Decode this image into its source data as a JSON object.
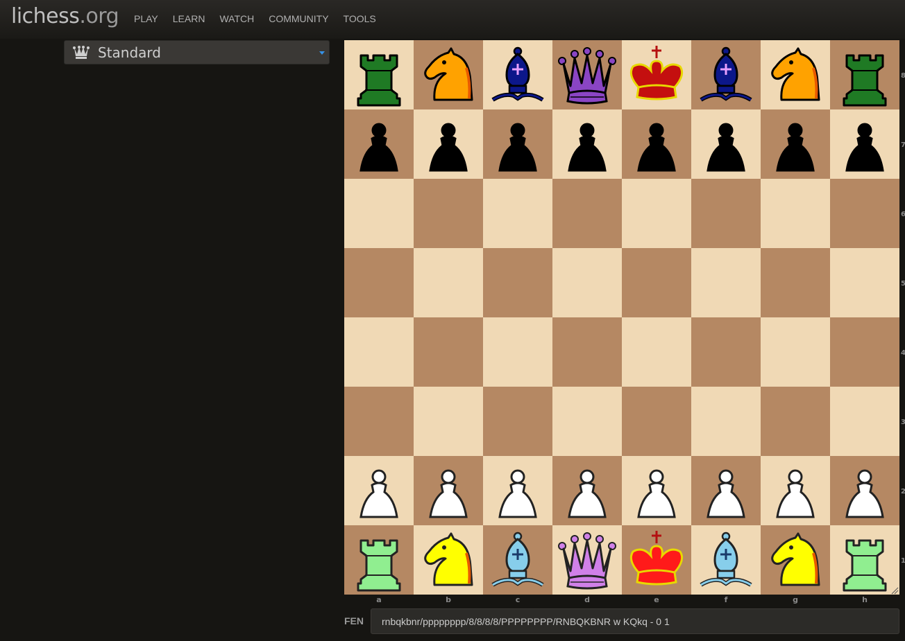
{
  "app": {
    "logo_main": "lichess",
    "logo_tld": ".org"
  },
  "nav": [
    "PLAY",
    "LEARN",
    "WATCH",
    "COMMUNITY",
    "TOOLS"
  ],
  "variant": {
    "icon": "crown-icon",
    "label": "Standard",
    "caret_color": "#3692e7"
  },
  "board": {
    "light_color": "#f0d9b5",
    "dark_color": "#b58863",
    "rows": [
      [
        "r",
        "n",
        "b",
        "q",
        "k",
        "b",
        "n",
        "r"
      ],
      [
        "p",
        "p",
        "p",
        "p",
        "p",
        "p",
        "p",
        "p"
      ],
      [
        "",
        "",
        "",
        "",
        "",
        "",
        "",
        ""
      ],
      [
        "",
        "",
        "",
        "",
        "",
        "",
        "",
        ""
      ],
      [
        "",
        "",
        "",
        "",
        "",
        "",
        "",
        ""
      ],
      [
        "",
        "",
        "",
        "",
        "",
        "",
        "",
        ""
      ],
      [
        "P",
        "P",
        "P",
        "P",
        "P",
        "P",
        "P",
        "P"
      ],
      [
        "R",
        "N",
        "B",
        "Q",
        "K",
        "B",
        "N",
        "R"
      ]
    ],
    "files": [
      "a",
      "b",
      "c",
      "d",
      "e",
      "f",
      "g",
      "h"
    ],
    "ranks": [
      "8",
      "7",
      "6",
      "5",
      "4",
      "3",
      "2",
      "1"
    ],
    "piece_colors": {
      "r": "#1f7a24",
      "n": "#ffa200",
      "b": "#0c178a",
      "q": "#8a45c4",
      "k": "#c40f0f",
      "p": "#000000",
      "R": "#90ee90",
      "N": "#ffff00",
      "B": "#87ceeb",
      "Q": "#d080e8",
      "K": "#ff1a1a",
      "P": "#ffffff"
    }
  },
  "fen": {
    "label": "FEN",
    "value": "rnbqkbnr/pppppppp/8/8/8/8/PPPPPPPP/RNBQKBNR w KQkq - 0 1"
  }
}
